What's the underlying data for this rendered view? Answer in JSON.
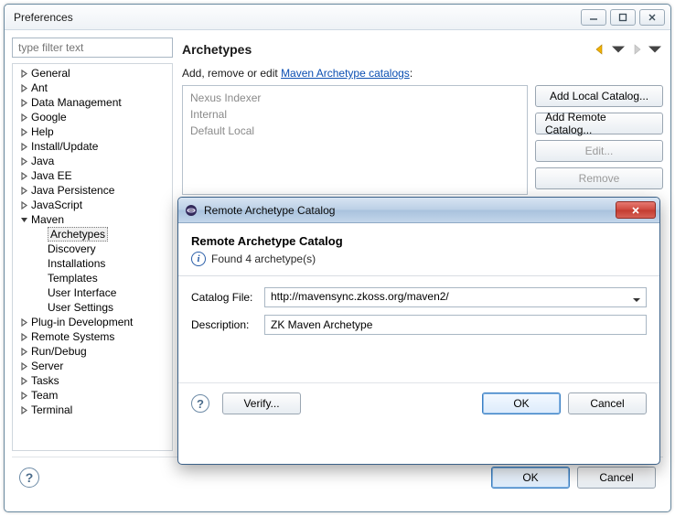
{
  "window": {
    "title": "Preferences",
    "filter_placeholder": "type filter text"
  },
  "tree": {
    "items": [
      {
        "label": "General",
        "children": true,
        "open": false
      },
      {
        "label": "Ant",
        "children": true,
        "open": false
      },
      {
        "label": "Data Management",
        "children": true,
        "open": false
      },
      {
        "label": "Google",
        "children": true,
        "open": false
      },
      {
        "label": "Help",
        "children": true,
        "open": false
      },
      {
        "label": "Install/Update",
        "children": true,
        "open": false
      },
      {
        "label": "Java",
        "children": true,
        "open": false
      },
      {
        "label": "Java EE",
        "children": true,
        "open": false
      },
      {
        "label": "Java Persistence",
        "children": true,
        "open": false
      },
      {
        "label": "JavaScript",
        "children": true,
        "open": false
      },
      {
        "label": "Maven",
        "children": true,
        "open": true,
        "sub": [
          {
            "label": "Archetypes",
            "selected": true
          },
          {
            "label": "Discovery"
          },
          {
            "label": "Installations"
          },
          {
            "label": "Templates"
          },
          {
            "label": "User Interface"
          },
          {
            "label": "User Settings"
          }
        ]
      },
      {
        "label": "Plug-in Development",
        "children": true,
        "open": false
      },
      {
        "label": "Remote Systems",
        "children": true,
        "open": false
      },
      {
        "label": "Run/Debug",
        "children": true,
        "open": false
      },
      {
        "label": "Server",
        "children": true,
        "open": false
      },
      {
        "label": "Tasks",
        "children": true,
        "open": false
      },
      {
        "label": "Team",
        "children": true,
        "open": false
      },
      {
        "label": "Terminal",
        "children": true,
        "open": false
      }
    ]
  },
  "page": {
    "title": "Archetypes",
    "instruction_prefix": "Add, remove or edit ",
    "instruction_link": "Maven Archetype catalogs",
    "instruction_suffix": ":",
    "catalogs": [
      "Nexus Indexer",
      "Internal",
      "Default Local"
    ],
    "buttons": {
      "add_local": "Add Local Catalog...",
      "add_remote": "Add Remote Catalog...",
      "edit": "Edit...",
      "remove": "Remove"
    }
  },
  "footer": {
    "ok": "OK",
    "cancel": "Cancel"
  },
  "dialog": {
    "window_title": "Remote Archetype Catalog",
    "heading": "Remote Archetype Catalog",
    "status": "Found 4 archetype(s)",
    "labels": {
      "catalog_file": "Catalog File:",
      "description": "Description:"
    },
    "values": {
      "catalog_file": "http://mavensync.zkoss.org/maven2/",
      "description": "ZK Maven Archetype"
    },
    "buttons": {
      "verify": "Verify...",
      "ok": "OK",
      "cancel": "Cancel"
    }
  }
}
